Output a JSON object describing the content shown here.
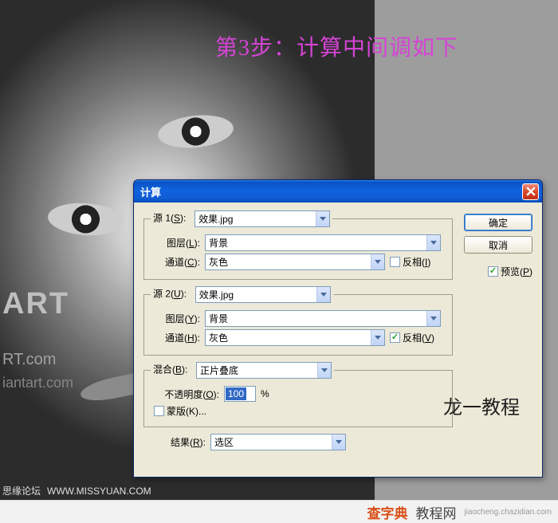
{
  "overlay_title": "第3步：计算中间调如下",
  "watermarks": {
    "art": "ART",
    "domain1": "RT.com",
    "domain2": "iantart.com",
    "forum": "思缘论坛",
    "forum_url": "WWW.MISSYUAN.COM"
  },
  "footer": {
    "chazidian": "查字典",
    "tutorial": "教程网",
    "url": "jiaocheng.chazidian.com"
  },
  "dialog": {
    "title": "计算",
    "ok": "确定",
    "cancel": "取消",
    "preview": "预览(",
    "preview_u": "P",
    "preview_end": ")",
    "source1": {
      "legend_pre": "源 1(",
      "legend_u": "S",
      "legend_post": "):",
      "file": "效果.jpg",
      "layer_lbl_pre": "图层(",
      "layer_lbl_u": "L",
      "layer_lbl_post": "):",
      "layer": "背景",
      "channel_lbl_pre": "通道(",
      "channel_lbl_u": "C",
      "channel_lbl_post": "):",
      "channel": "灰色",
      "invert_pre": "反相(",
      "invert_u": "I",
      "invert_post": ")",
      "invert_checked": false
    },
    "source2": {
      "legend_pre": "源 2(",
      "legend_u": "U",
      "legend_post": "):",
      "file": "效果.jpg",
      "layer_lbl_pre": "图层(",
      "layer_lbl_u": "Y",
      "layer_lbl_post": "):",
      "layer": "背景",
      "channel_lbl_pre": "通道(",
      "channel_lbl_u": "H",
      "channel_lbl_post": "):",
      "channel": "灰色",
      "invert_pre": "反相(",
      "invert_u": "V",
      "invert_post": ")",
      "invert_checked": true
    },
    "blend": {
      "label_pre": "混合(",
      "label_u": "B",
      "label_post": "):",
      "mode": "正片叠底",
      "opacity_lbl_pre": "不透明度(",
      "opacity_lbl_u": "O",
      "opacity_lbl_post": "):",
      "opacity": "100",
      "opacity_unit": "%",
      "mask_pre": "蒙版(",
      "mask_u": "K",
      "mask_post": ")...",
      "mask_checked": false
    },
    "result": {
      "label_pre": "结果(",
      "label_u": "R",
      "label_post": "):",
      "value": "选区"
    },
    "credit": "龙一教程"
  }
}
